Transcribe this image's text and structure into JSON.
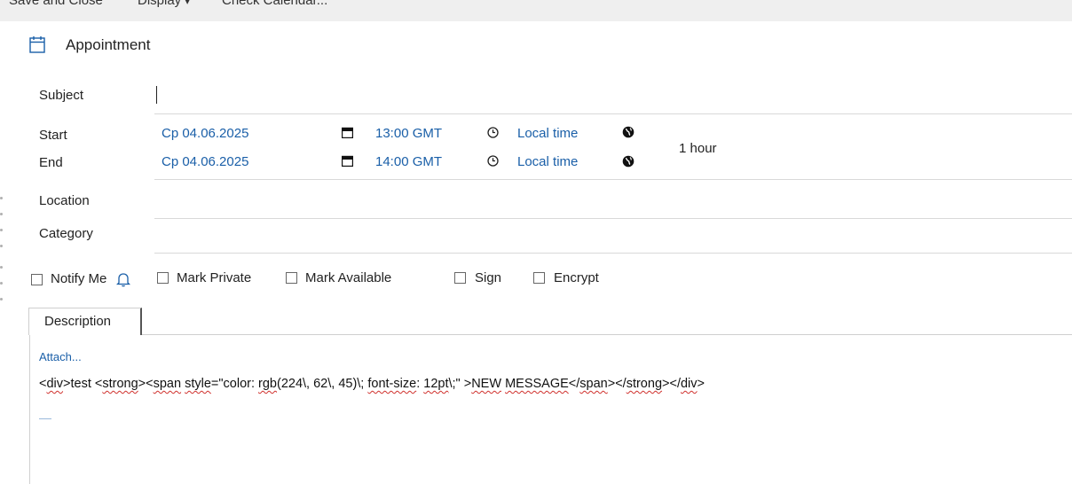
{
  "toolbar": {
    "save_close": "Save and Close",
    "display": "Display",
    "display_chevron": "▾",
    "check_calendar": "Check Calendar..."
  },
  "header": {
    "title": "Appointment",
    "icon": "calendar-icon"
  },
  "form": {
    "subject_label": "Subject",
    "subject_value": "",
    "start_label": "Start",
    "end_label": "End",
    "start_date": "Cp 04.06.2025",
    "start_time": "13:00 GMT",
    "start_tz": "Local time",
    "end_date": "Cp 04.06.2025",
    "end_time": "14:00 GMT",
    "end_tz": "Local time",
    "duration": "1 hour",
    "location_label": "Location",
    "category_label": "Category"
  },
  "options": {
    "notify_me": "Notify Me",
    "notify_me_checked": false,
    "mark_private": "Mark Private",
    "mark_private_checked": false,
    "mark_available": "Mark Available",
    "mark_available_checked": false,
    "sign": "Sign",
    "sign_checked": false,
    "encrypt": "Encrypt",
    "encrypt_checked": false
  },
  "description": {
    "tab_label": "Description",
    "attach_label": "Attach...",
    "body_parts": [
      "<",
      "div",
      ">test <",
      "strong",
      "><",
      "span",
      " ",
      "style",
      "=\"color: ",
      "rgb",
      "(224\\, 62\\, 45)\\; ",
      "font-size",
      ": ",
      "12pt",
      "\\;\" >",
      "NEW",
      " ",
      "MESSAGE",
      "</",
      "span",
      "></",
      "strong",
      "></",
      "div",
      ">"
    ]
  },
  "colors": {
    "link": "#1a5fa8",
    "toolbar_bg": "#efefef",
    "separator": "#d9d9d9",
    "spell_underline": "#d0312d"
  }
}
